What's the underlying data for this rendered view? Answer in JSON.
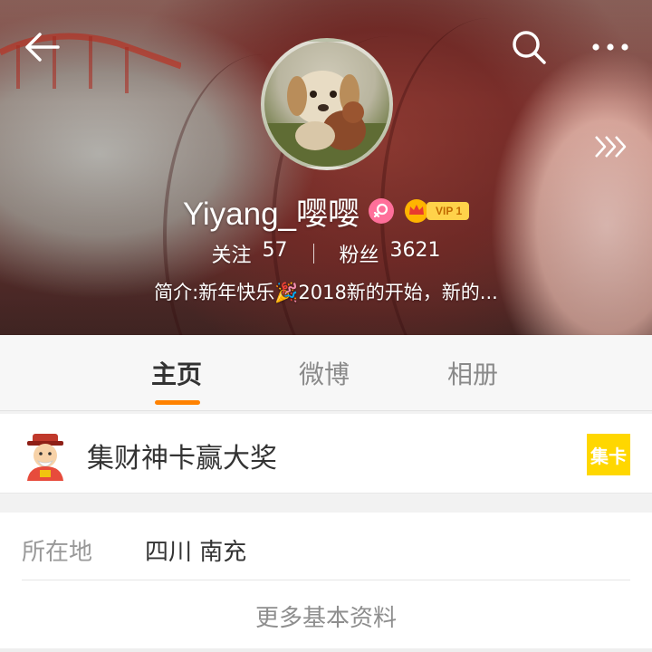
{
  "header": {
    "icons": [
      "back-arrow-icon",
      "search-icon",
      "more-dots-icon",
      "swipe-chevrons-icon"
    ]
  },
  "profile": {
    "username": "Yiyang_嘤嘤",
    "gender_icon": "female-icon",
    "vip_label": "VIP 1",
    "following_label": "关注",
    "following_count": "57",
    "followers_label": "粉丝",
    "followers_count": "3621",
    "bio": "简介:新年快乐🎉2018新的开始，新的..."
  },
  "tabs": [
    {
      "label": "主页",
      "active": true
    },
    {
      "label": "微博",
      "active": false
    },
    {
      "label": "相册",
      "active": false
    }
  ],
  "promo": {
    "text": "集财神卡赢大奖",
    "badge": "集卡",
    "badge_color": "#ffd700"
  },
  "info": {
    "location_label": "所在地",
    "location_value": "四川 南充",
    "more_label": "更多基本资料"
  },
  "colors": {
    "accent": "#ff8200",
    "gender_pink": "#ff6f9a",
    "vip_gold": "#ffd24a"
  }
}
